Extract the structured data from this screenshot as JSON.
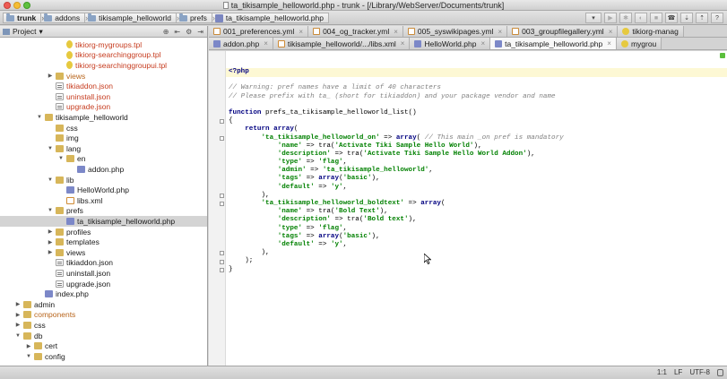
{
  "window": {
    "title": "ta_tikisample_helloworld.php - trunk - [/Library/WebServer/Documents/trunk]"
  },
  "breadcrumbs": [
    "trunk",
    "addons",
    "tikisample_helloworld",
    "prefs",
    "ta_tikisample_helloworld.php"
  ],
  "project_panel": {
    "selector_label": "Project"
  },
  "tree": [
    {
      "label": "tikiorg-mygroups.tpl",
      "indent": 5,
      "icon": "tpl",
      "arrow": "",
      "color": "red"
    },
    {
      "label": "tikiorg-searchinggroup.tpl",
      "indent": 5,
      "icon": "tpl",
      "arrow": "",
      "color": "red"
    },
    {
      "label": "tikiorg-searchinggroupui.tpl",
      "indent": 5,
      "icon": "tpl",
      "arrow": "",
      "color": "red"
    },
    {
      "label": "views",
      "indent": 4,
      "icon": "folder",
      "arrow": "▶",
      "color": "orange"
    },
    {
      "label": "tikiaddon.json",
      "indent": 4,
      "icon": "json",
      "arrow": "",
      "color": "red"
    },
    {
      "label": "uninstall.json",
      "indent": 4,
      "icon": "json",
      "arrow": "",
      "color": "red"
    },
    {
      "label": "upgrade.json",
      "indent": 4,
      "icon": "json",
      "arrow": "",
      "color": "red"
    },
    {
      "label": "tikisample_helloworld",
      "indent": 3,
      "icon": "folder",
      "arrow": "▼",
      "color": ""
    },
    {
      "label": "css",
      "indent": 4,
      "icon": "folder",
      "arrow": "",
      "color": ""
    },
    {
      "label": "img",
      "indent": 4,
      "icon": "folder",
      "arrow": "",
      "color": ""
    },
    {
      "label": "lang",
      "indent": 4,
      "icon": "folder",
      "arrow": "▼",
      "color": ""
    },
    {
      "label": "en",
      "indent": 5,
      "icon": "folder",
      "arrow": "▼",
      "color": ""
    },
    {
      "label": "addon.php",
      "indent": 6,
      "icon": "php",
      "arrow": "",
      "color": ""
    },
    {
      "label": "lib",
      "indent": 4,
      "icon": "folder",
      "arrow": "▼",
      "color": ""
    },
    {
      "label": "HelloWorld.php",
      "indent": 5,
      "icon": "php",
      "arrow": "",
      "color": ""
    },
    {
      "label": "libs.xml",
      "indent": 5,
      "icon": "xml",
      "arrow": "",
      "color": ""
    },
    {
      "label": "prefs",
      "indent": 4,
      "icon": "folder",
      "arrow": "▼",
      "color": ""
    },
    {
      "label": "ta_tikisample_helloworld.php",
      "indent": 5,
      "icon": "php",
      "arrow": "",
      "color": "",
      "selected": true
    },
    {
      "label": "profiles",
      "indent": 4,
      "icon": "folder",
      "arrow": "▶",
      "color": ""
    },
    {
      "label": "templates",
      "indent": 4,
      "icon": "folder",
      "arrow": "▶",
      "color": ""
    },
    {
      "label": "views",
      "indent": 4,
      "icon": "folder",
      "arrow": "▶",
      "color": ""
    },
    {
      "label": "tikiaddon.json",
      "indent": 4,
      "icon": "json",
      "arrow": "",
      "color": ""
    },
    {
      "label": "uninstall.json",
      "indent": 4,
      "icon": "json",
      "arrow": "",
      "color": ""
    },
    {
      "label": "upgrade.json",
      "indent": 4,
      "icon": "json",
      "arrow": "",
      "color": ""
    },
    {
      "label": "index.php",
      "indent": 3,
      "icon": "php",
      "arrow": "",
      "color": ""
    },
    {
      "label": "admin",
      "indent": 1,
      "icon": "folder",
      "arrow": "▶",
      "color": ""
    },
    {
      "label": "components",
      "indent": 1,
      "icon": "folder",
      "arrow": "▶",
      "color": "orange"
    },
    {
      "label": "css",
      "indent": 1,
      "icon": "folder",
      "arrow": "▶",
      "color": ""
    },
    {
      "label": "db",
      "indent": 1,
      "icon": "folder",
      "arrow": "▼",
      "color": ""
    },
    {
      "label": "cert",
      "indent": 2,
      "icon": "folder",
      "arrow": "▶",
      "color": ""
    },
    {
      "label": "config",
      "indent": 2,
      "icon": "folder",
      "arrow": "▼",
      "color": ""
    }
  ],
  "tabs_row1": [
    {
      "label": "001_preferences.yml",
      "icon": "yml"
    },
    {
      "label": "004_og_tracker.yml",
      "icon": "yml"
    },
    {
      "label": "005_syswikipages.yml",
      "icon": "yml"
    },
    {
      "label": "003_groupfilegallery.yml",
      "icon": "yml"
    },
    {
      "label": "tikiorg-manag",
      "icon": "tpl"
    }
  ],
  "tabs_row2": [
    {
      "label": "addon.php",
      "icon": "php",
      "active": false
    },
    {
      "label": "tikisample_helloworld/.../libs.xml",
      "icon": "xml",
      "active": false
    },
    {
      "label": "HelloWorld.php",
      "icon": "php",
      "active": false
    },
    {
      "label": "ta_tikisample_helloworld.php",
      "icon": "php",
      "active": true
    },
    {
      "label": "mygrou",
      "icon": "tpl",
      "active": false
    }
  ],
  "code_lines": [
    [
      {
        "t": "<?php",
        "c": "kw"
      }
    ],
    [],
    [
      {
        "t": "// Warning: pref names have a limit of 40 characters",
        "c": "cm"
      }
    ],
    [
      {
        "t": "// Please prefix with ta_ (short for tikiaddon) and your package vendor and name",
        "c": "cm"
      }
    ],
    [],
    [
      {
        "t": "function ",
        "c": "kw"
      },
      {
        "t": "prefs_ta_tikisample_helloworld_list()",
        "c": ""
      }
    ],
    [
      {
        "t": "{",
        "c": ""
      }
    ],
    [
      {
        "t": "    ",
        "c": ""
      },
      {
        "t": "return array",
        "c": "kw"
      },
      {
        "t": "(",
        "c": ""
      }
    ],
    [
      {
        "t": "        ",
        "c": ""
      },
      {
        "t": "'ta_tikisample_helloworld_on'",
        "c": "str"
      },
      {
        "t": " => ",
        "c": ""
      },
      {
        "t": "array",
        "c": "kw"
      },
      {
        "t": "( ",
        "c": ""
      },
      {
        "t": "// This main _on pref is mandatory",
        "c": "cm"
      }
    ],
    [
      {
        "t": "            ",
        "c": ""
      },
      {
        "t": "'name'",
        "c": "str"
      },
      {
        "t": " => tra(",
        "c": ""
      },
      {
        "t": "'Activate Tiki Sample Hello World'",
        "c": "str"
      },
      {
        "t": "),",
        "c": ""
      }
    ],
    [
      {
        "t": "            ",
        "c": ""
      },
      {
        "t": "'description'",
        "c": "str"
      },
      {
        "t": " => tra(",
        "c": ""
      },
      {
        "t": "'Activate Tiki Sample Hello World Addon'",
        "c": "str"
      },
      {
        "t": "),",
        "c": ""
      }
    ],
    [
      {
        "t": "            ",
        "c": ""
      },
      {
        "t": "'type'",
        "c": "str"
      },
      {
        "t": " => ",
        "c": ""
      },
      {
        "t": "'flag'",
        "c": "str"
      },
      {
        "t": ",",
        "c": ""
      }
    ],
    [
      {
        "t": "            ",
        "c": ""
      },
      {
        "t": "'admin'",
        "c": "str"
      },
      {
        "t": " => ",
        "c": ""
      },
      {
        "t": "'ta_tikisample_helloworld'",
        "c": "str"
      },
      {
        "t": ",",
        "c": ""
      }
    ],
    [
      {
        "t": "            ",
        "c": ""
      },
      {
        "t": "'tags'",
        "c": "str"
      },
      {
        "t": " => ",
        "c": ""
      },
      {
        "t": "array",
        "c": "kw"
      },
      {
        "t": "(",
        "c": ""
      },
      {
        "t": "'basic'",
        "c": "str"
      },
      {
        "t": "),",
        "c": ""
      }
    ],
    [
      {
        "t": "            ",
        "c": ""
      },
      {
        "t": "'default'",
        "c": "str"
      },
      {
        "t": " => ",
        "c": ""
      },
      {
        "t": "'y'",
        "c": "str"
      },
      {
        "t": ",",
        "c": ""
      }
    ],
    [
      {
        "t": "        ),",
        "c": ""
      }
    ],
    [
      {
        "t": "        ",
        "c": ""
      },
      {
        "t": "'ta_tikisample_helloworld_boldtext'",
        "c": "str"
      },
      {
        "t": " => ",
        "c": ""
      },
      {
        "t": "array",
        "c": "kw"
      },
      {
        "t": "(",
        "c": ""
      }
    ],
    [
      {
        "t": "            ",
        "c": ""
      },
      {
        "t": "'name'",
        "c": "str"
      },
      {
        "t": " => tra(",
        "c": ""
      },
      {
        "t": "'Bold Text'",
        "c": "str"
      },
      {
        "t": "),",
        "c": ""
      }
    ],
    [
      {
        "t": "            ",
        "c": ""
      },
      {
        "t": "'description'",
        "c": "str"
      },
      {
        "t": " => tra(",
        "c": ""
      },
      {
        "t": "'Bold text'",
        "c": "str"
      },
      {
        "t": "),",
        "c": ""
      }
    ],
    [
      {
        "t": "            ",
        "c": ""
      },
      {
        "t": "'type'",
        "c": "str"
      },
      {
        "t": " => ",
        "c": ""
      },
      {
        "t": "'flag'",
        "c": "str"
      },
      {
        "t": ",",
        "c": ""
      }
    ],
    [
      {
        "t": "            ",
        "c": ""
      },
      {
        "t": "'tags'",
        "c": "str"
      },
      {
        "t": " => ",
        "c": ""
      },
      {
        "t": "array",
        "c": "kw"
      },
      {
        "t": "(",
        "c": ""
      },
      {
        "t": "'basic'",
        "c": "str"
      },
      {
        "t": "),",
        "c": ""
      }
    ],
    [
      {
        "t": "            ",
        "c": ""
      },
      {
        "t": "'default'",
        "c": "str"
      },
      {
        "t": " => ",
        "c": ""
      },
      {
        "t": "'y'",
        "c": "str"
      },
      {
        "t": ",",
        "c": ""
      }
    ],
    [
      {
        "t": "        ),",
        "c": ""
      }
    ],
    [
      {
        "t": "    );",
        "c": ""
      }
    ],
    [
      {
        "t": "}",
        "c": ""
      }
    ]
  ],
  "status_bar": {
    "position": "1:1",
    "line_ending": "LF",
    "encoding": "UTF-8"
  },
  "colors": {
    "keyword": "#000080",
    "string": "#008000",
    "comment": "#808080",
    "selection": "#d4d4d4"
  }
}
